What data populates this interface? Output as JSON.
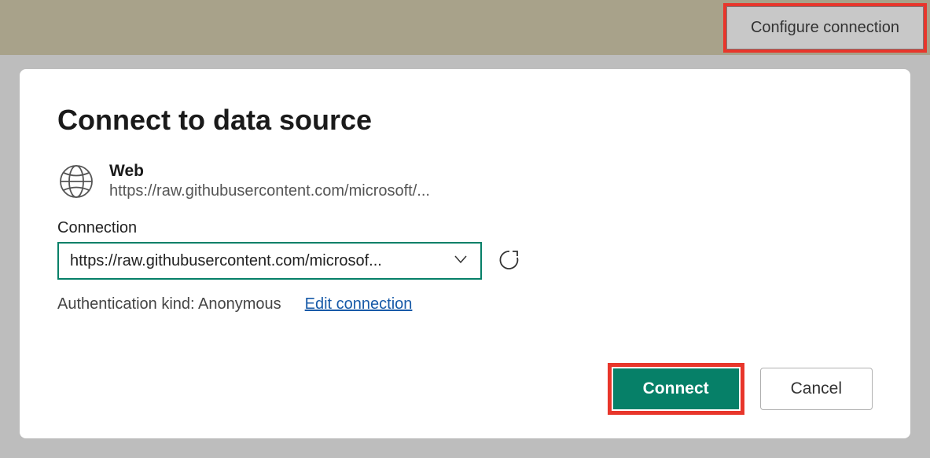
{
  "toolbar": {
    "configure_label": "Configure connection"
  },
  "dialog": {
    "title": "Connect to data source",
    "source": {
      "name": "Web",
      "url": "https://raw.githubusercontent.com/microsoft/..."
    },
    "connection": {
      "label": "Connection",
      "selected": "https://raw.githubusercontent.com/microsof..."
    },
    "auth": {
      "text": "Authentication kind: Anonymous",
      "edit_label": "Edit connection"
    },
    "buttons": {
      "connect": "Connect",
      "cancel": "Cancel"
    }
  }
}
